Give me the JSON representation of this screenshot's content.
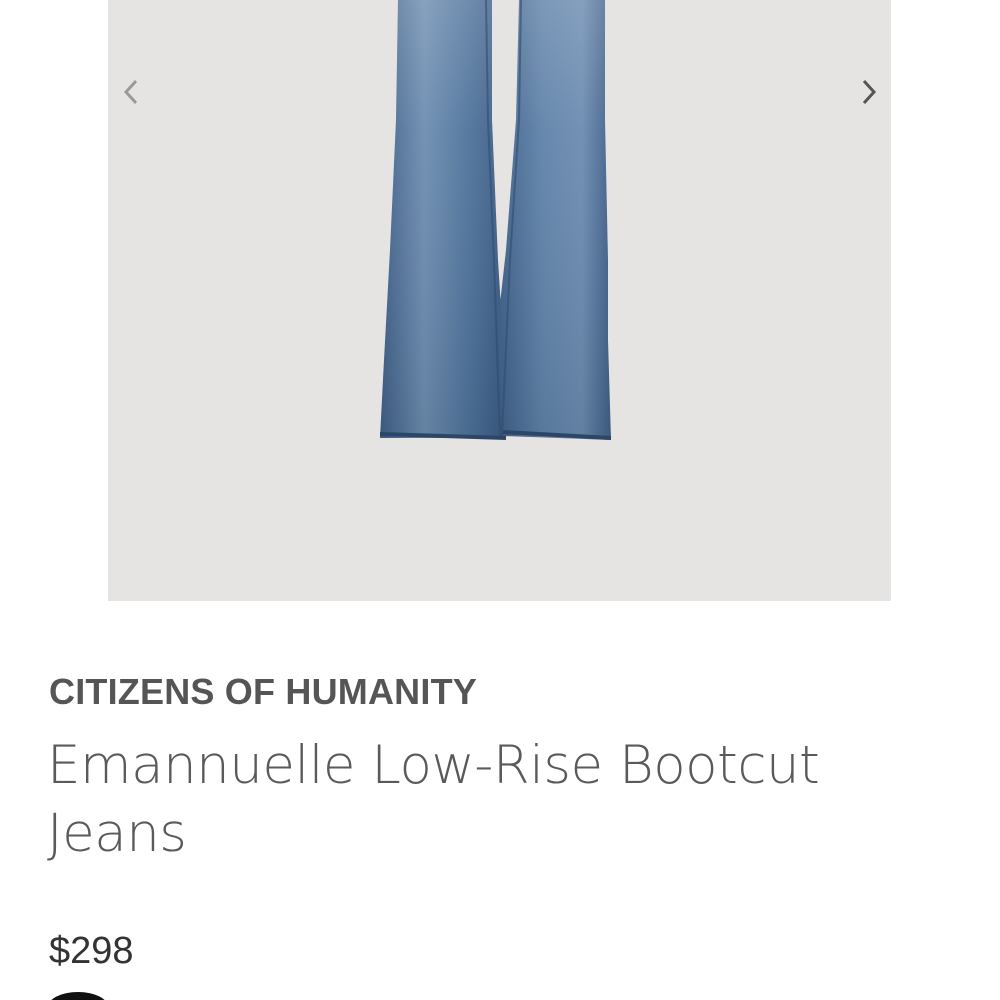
{
  "gallery": {
    "prev_icon": "chevron-left-icon",
    "next_icon": "chevron-right-icon",
    "background_color": "#e6e4e2",
    "image_subject": "jeans"
  },
  "product": {
    "brand": "CITIZENS OF HUMANITY",
    "title": "Emannuelle Low-Rise Bootcut Jeans",
    "price": "$298"
  },
  "colors": {
    "brand_text": "#555555",
    "title_text": "#5a5a5a",
    "price_text": "#333333",
    "denim": "#4a6d9a"
  }
}
